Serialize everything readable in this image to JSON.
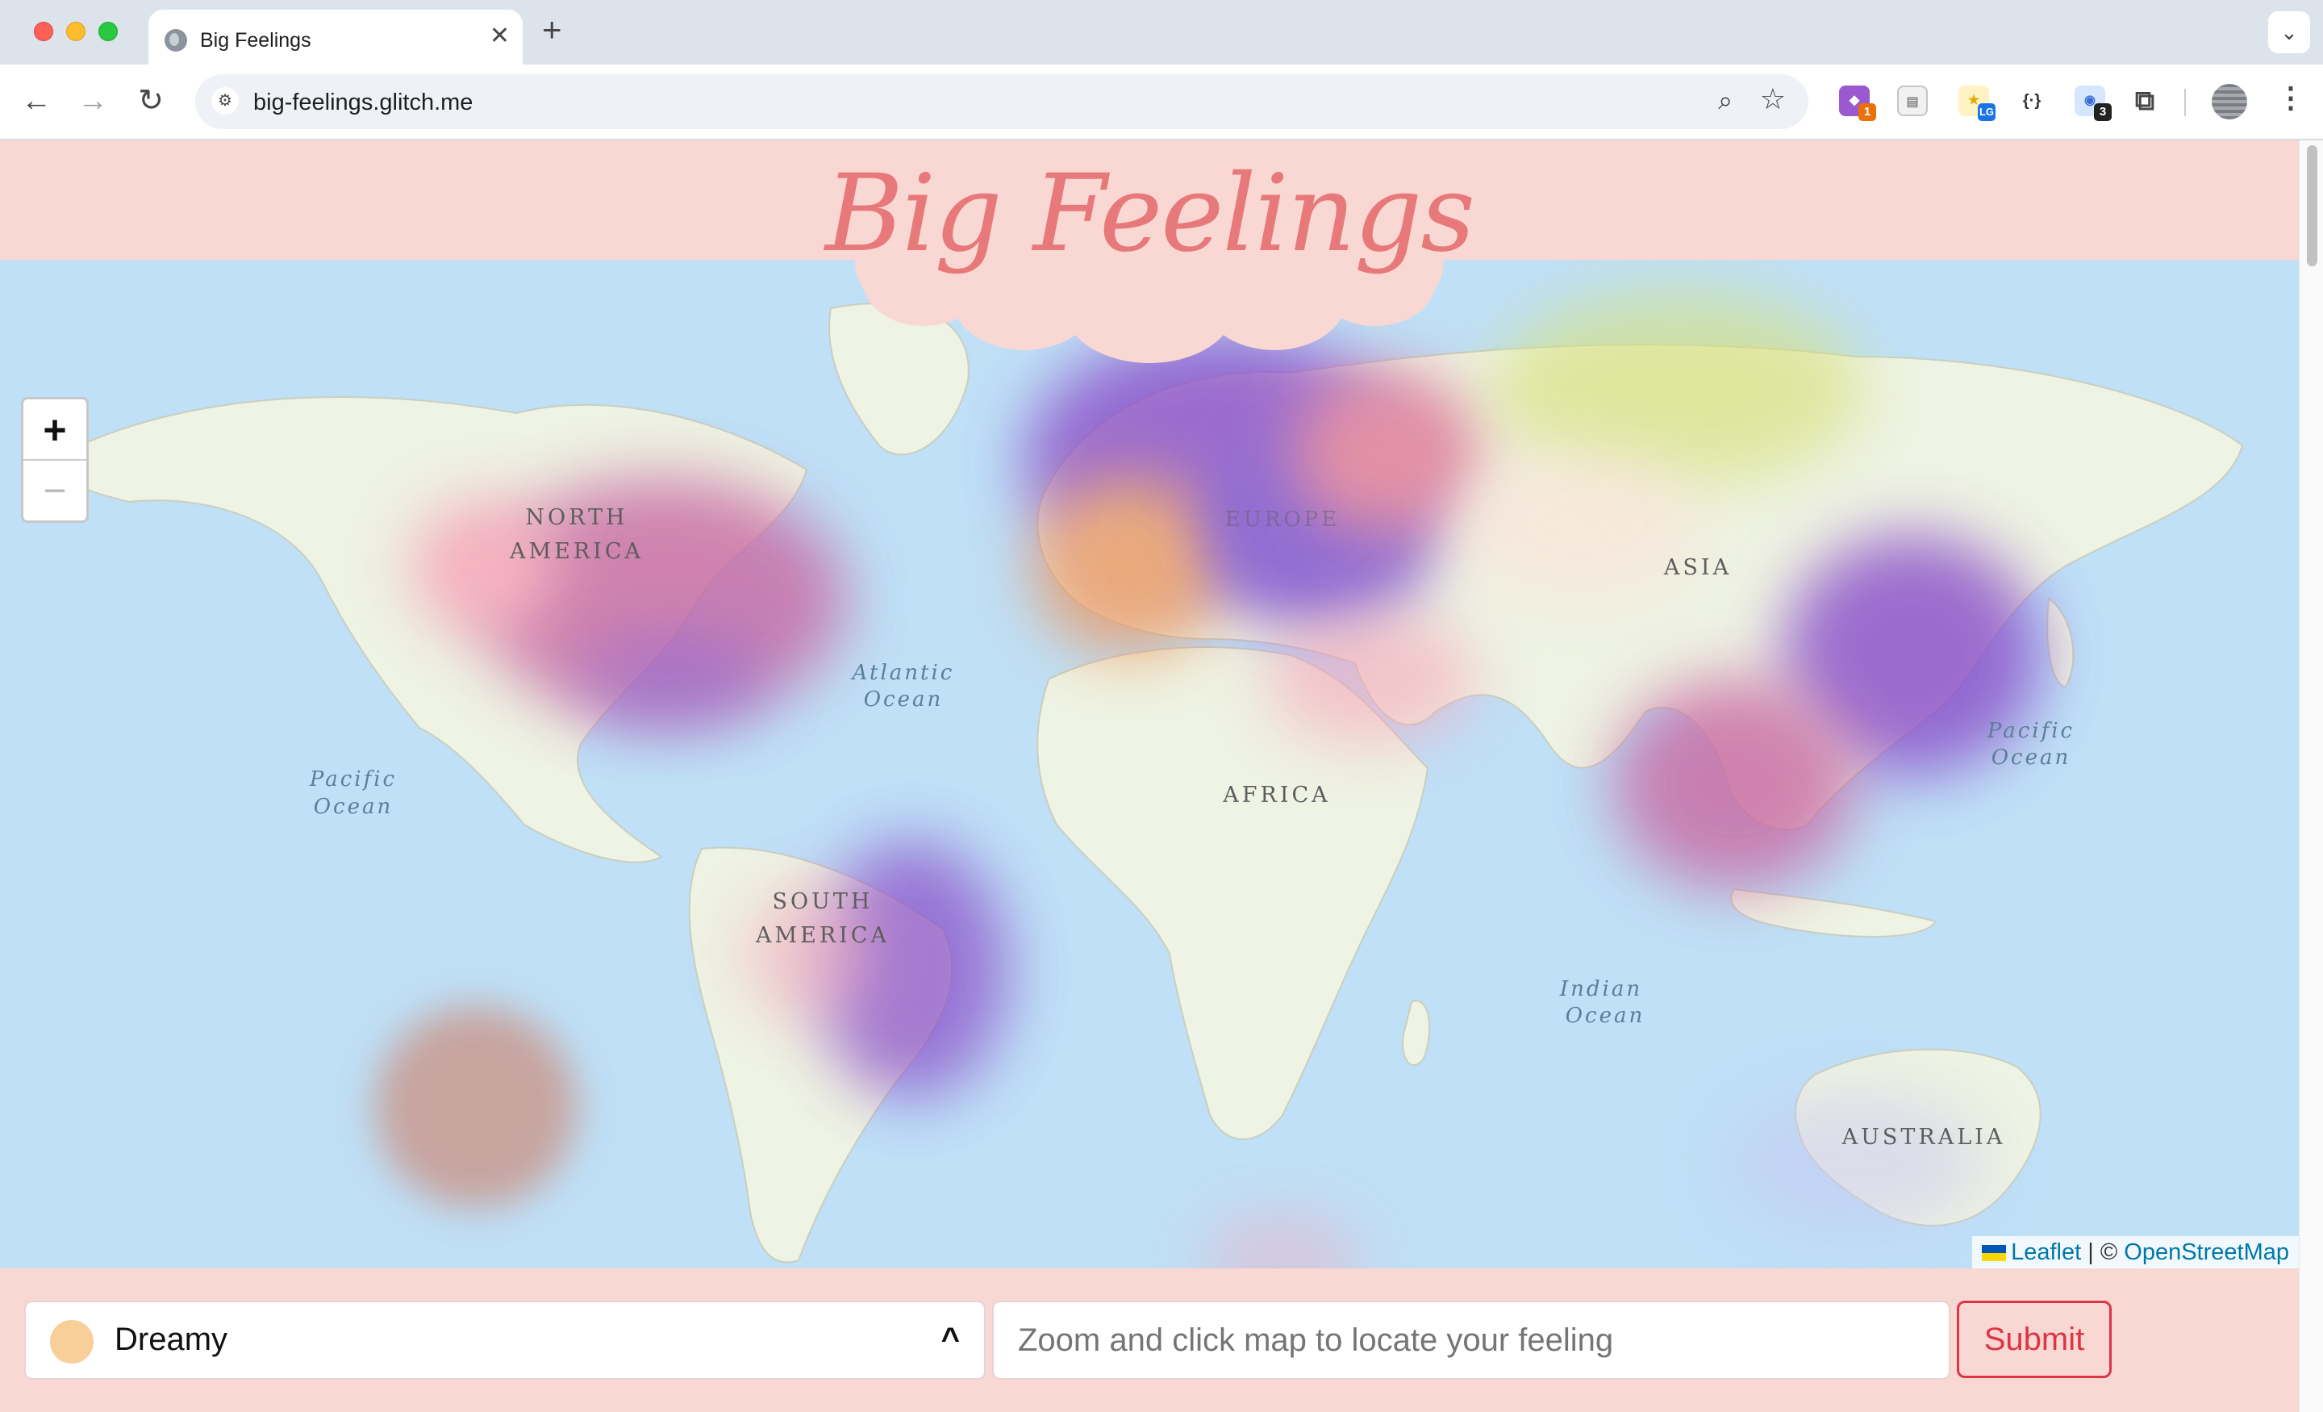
{
  "browser": {
    "tab_title": "Big Feelings",
    "url": "big-feelings.glitch.me",
    "extension_badges": [
      "1",
      "LG",
      "3"
    ]
  },
  "page": {
    "title": "Big Feelings",
    "zoom_in_label": "+",
    "zoom_out_label": "−",
    "attribution": {
      "leaflet": "Leaflet",
      "separator": "| ©",
      "osm": "OpenStreetMap"
    },
    "map_labels": {
      "north_america_1": "NORTH",
      "north_america_2": "AMERICA",
      "south_america_1": "SOUTH",
      "south_america_2": "AMERICA",
      "europe": "EUROPE",
      "asia": "ASIA",
      "africa": "AFRICA",
      "australia": "AUSTRALIA",
      "atlantic_1": "Atlantic",
      "atlantic_2": "Ocean",
      "pacific_w_1": "Pacific",
      "pacific_w_2": "Ocean",
      "pacific_e_1": "Pacific",
      "pacific_e_2": "Ocean",
      "indian_1": "Indian",
      "indian_2": "Ocean"
    },
    "mood": {
      "selected": "Dreamy",
      "color": "#f8cf98",
      "caret": "^"
    },
    "location_placeholder": "Zoom and click map to locate your feeling",
    "submit_label": "Submit"
  },
  "colors": {
    "page_background": "#f9d7d3",
    "title_color": "#e7797a",
    "submit_color": "#dc3545",
    "heat_colors": [
      "#8a4fc9",
      "#c86aa3",
      "#e99a66",
      "#d6e07a",
      "#f7a3b8"
    ]
  }
}
